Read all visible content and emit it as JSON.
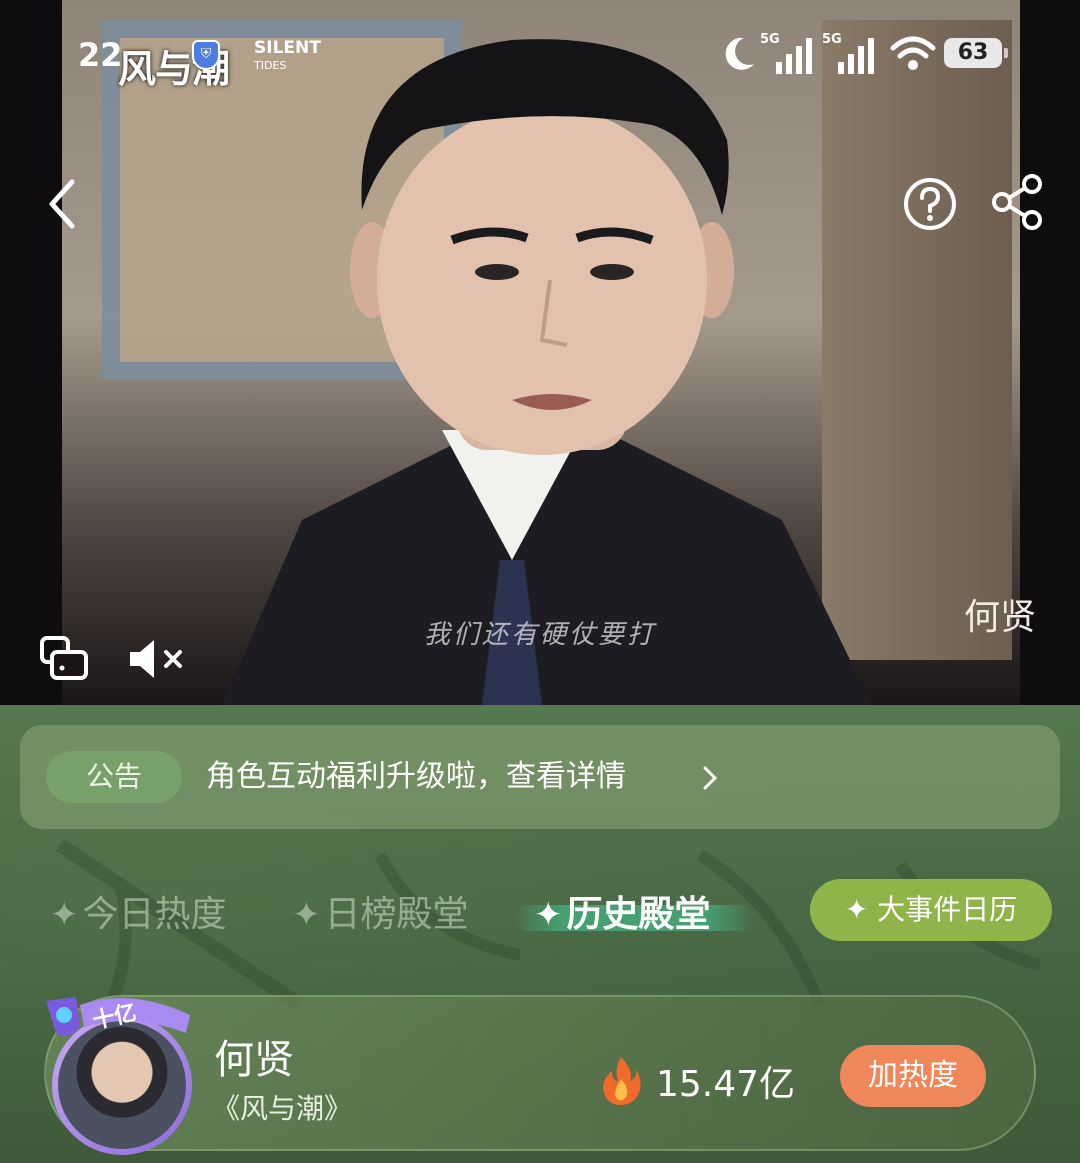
{
  "status_bar": {
    "time": "22",
    "show_logo": "风与潮",
    "show_logo_en_line1": "SILENT",
    "show_logo_en_line2": "TIDES",
    "network_1": "5G",
    "network_2": "5G",
    "battery": "63"
  },
  "video": {
    "subtitle": "我们还有硬仗要打",
    "corner_name": "何贤",
    "icons": [
      "back-icon",
      "help-icon",
      "share-icon",
      "pip-icon",
      "mute-icon"
    ]
  },
  "notice": {
    "tag": "公告",
    "text": "角色互动福利升级啦，查看详情"
  },
  "tabs": [
    {
      "label": "今日热度",
      "active": false
    },
    {
      "label": "日榜殿堂",
      "active": false
    },
    {
      "label": "历史殿堂",
      "active": true
    }
  ],
  "events_button": "✦ 大事件日历",
  "character_card": {
    "badge": "十亿",
    "name": "何贤",
    "show": "《风与潮》",
    "heat": "15.47亿",
    "action": "加热度"
  },
  "colors": {
    "panel_green": "#4a6a46",
    "events_button": "#8fb54a",
    "heat_button": "#f0875a",
    "avatar_ring": "#a989e6"
  }
}
